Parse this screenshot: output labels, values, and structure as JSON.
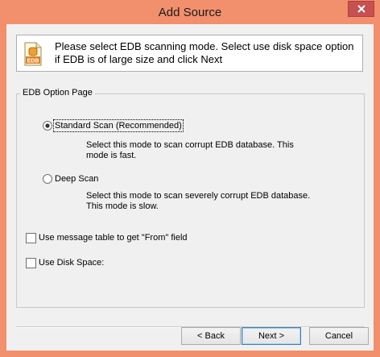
{
  "window": {
    "title": "Add Source"
  },
  "header": {
    "icon": "edb-database-icon",
    "icon_text": "EDB",
    "message": "Please select EDB scanning mode. Select use disk space option if EDB is of large size and click Next"
  },
  "group": {
    "label": "EDB Option Page",
    "options": [
      {
        "label": "Standard Scan (Recommended)",
        "selected": true,
        "description": "Select this mode to scan corrupt EDB database. This mode is fast."
      },
      {
        "label": "Deep Scan",
        "selected": false,
        "description": "Select this mode to scan severely corrupt EDB database. This mode is slow."
      }
    ],
    "checkboxes": [
      {
        "label": "Use message table to get \"From\" field",
        "checked": false
      },
      {
        "label": "Use Disk Space:",
        "checked": false
      }
    ]
  },
  "buttons": {
    "back": "< Back",
    "next": "Next >",
    "cancel": "Cancel"
  },
  "colors": {
    "frame": "#f28f6d",
    "close": "#c75050",
    "default_button_border": "#3c7fb1"
  }
}
